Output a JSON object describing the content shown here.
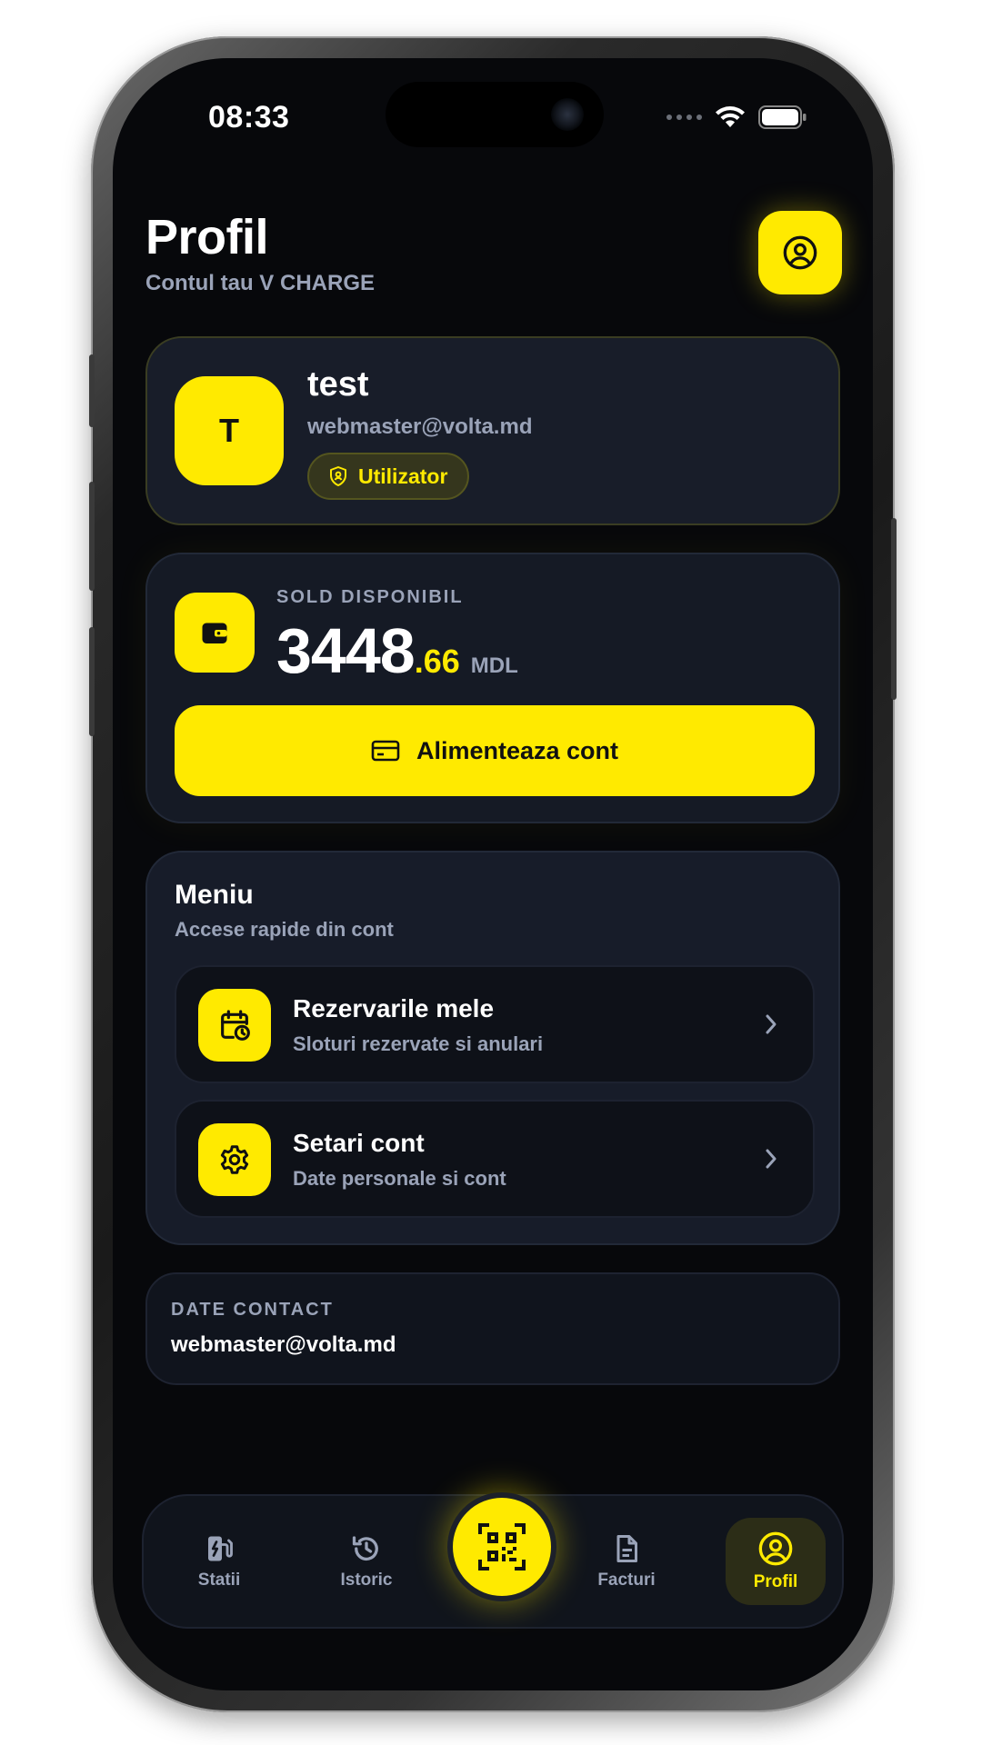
{
  "status": {
    "time": "08:33"
  },
  "header": {
    "title": "Profil",
    "subtitle": "Contul tau V CHARGE"
  },
  "user": {
    "initial": "T",
    "name": "test",
    "email": "webmaster@volta.md",
    "role": "Utilizator"
  },
  "balance": {
    "label": "SOLD DISPONIBIL",
    "integer": "3448",
    "decimal": ".66",
    "currency": "MDL",
    "topup_label": "Alimenteaza cont"
  },
  "menu": {
    "title": "Meniu",
    "subtitle": "Accese rapide din cont",
    "items": [
      {
        "title": "Rezervarile mele",
        "subtitle": "Sloturi rezervate si anulari",
        "icon": "calendar-clock-icon"
      },
      {
        "title": "Setari cont",
        "subtitle": "Date personale si cont",
        "icon": "gear-icon"
      }
    ]
  },
  "contact": {
    "label": "DATE CONTACT",
    "value": "webmaster@volta.md"
  },
  "tabs": [
    {
      "label": "Statii",
      "icon": "charging-station-icon"
    },
    {
      "label": "Istoric",
      "icon": "history-icon"
    },
    {
      "label": "Facturi",
      "icon": "document-icon"
    },
    {
      "label": "Profil",
      "icon": "user-circle-icon",
      "active": true
    }
  ],
  "colors": {
    "accent": "#ffea00",
    "background": "#07080b",
    "card": "#161b27",
    "muted_text": "#9aa3b8"
  }
}
